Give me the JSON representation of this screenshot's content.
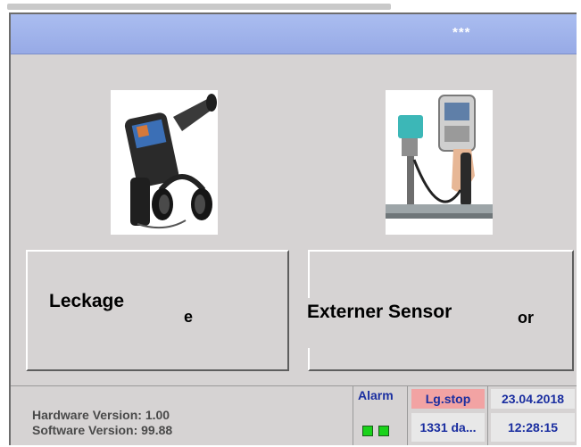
{
  "header": {
    "title": "***"
  },
  "modes": [
    {
      "label": "Leckage",
      "ghost_label": "e",
      "image": "leak-detector-with-headphones"
    },
    {
      "label": "Externer  Sensor",
      "ghost_label": "or",
      "image": "handheld-with-external-sensor"
    }
  ],
  "status": {
    "hardware_version": "Hardware Version: 1.00",
    "software_version": "Software Version: 99.88",
    "alarm_label": "Alarm",
    "logger_status": "Lg.stop",
    "days": "1331 da...",
    "date": "23.04.2018",
    "time": "12:28:15"
  },
  "colors": {
    "title_bar": "#9fb3eb",
    "panel": "#d6d3d3",
    "status_text": "#1a2ea0",
    "logger_stop_bg": "#f2a3a3",
    "led": "#1ad21a"
  }
}
